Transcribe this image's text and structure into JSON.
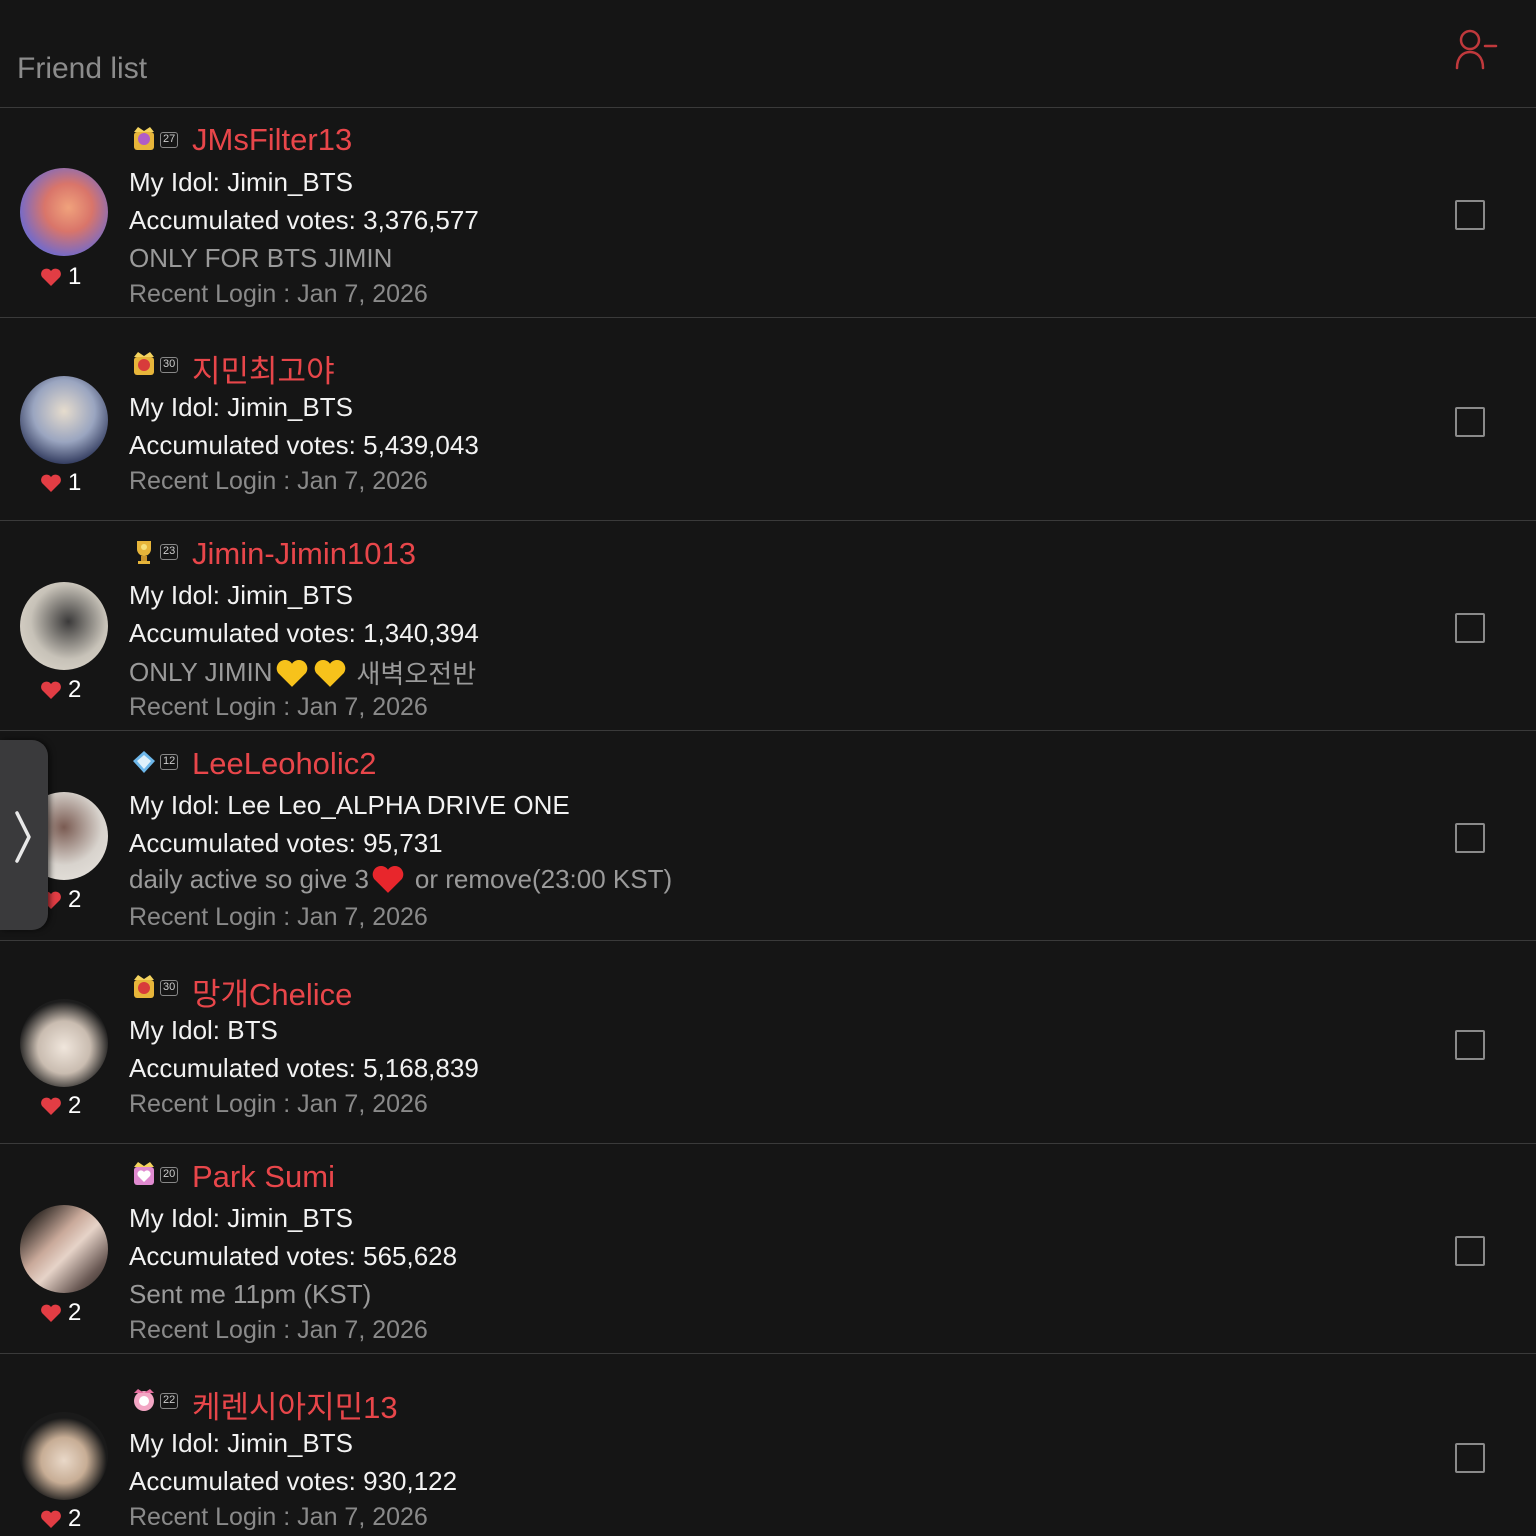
{
  "header": {
    "title": "Friend list",
    "remove_icon": "user-minus-icon"
  },
  "friends": [
    {
      "name": "JMsFilter13",
      "level": "27",
      "idol": "My Idol: Jimin_BTS",
      "votes": "Accumulated votes: 3,376,577",
      "message": "ONLY FOR BTS JIMIN",
      "login": "Recent Login : Jan 7, 2026",
      "hearts": "1"
    },
    {
      "name": "지민최고야",
      "level": "30",
      "idol": "My Idol: Jimin_BTS",
      "votes": "Accumulated votes: 5,439,043",
      "message": "",
      "login": "Recent Login : Jan 7, 2026",
      "hearts": "1"
    },
    {
      "name": "Jimin-Jimin1013",
      "level": "23",
      "idol": "My Idol: Jimin_BTS",
      "votes": "Accumulated votes: 1,340,394",
      "message_a": "ONLY JIMIN",
      "message_b": "새벽오전반",
      "login": "Recent Login : Jan 7, 2026",
      "hearts": "2"
    },
    {
      "name": "LeeLeoholic2",
      "level": "12",
      "idol": "My Idol: Lee Leo_ALPHA DRIVE ONE",
      "votes": "Accumulated votes: 95,731",
      "message_a": "daily active so give 3",
      "message_b": "or remove(23:00 KST)",
      "login": "Recent Login : Jan 7, 2026",
      "hearts": "2"
    },
    {
      "name": "망개Chelice",
      "level": "30",
      "idol": "My Idol: BTS",
      "votes": "Accumulated votes: 5,168,839",
      "message": "",
      "login": "Recent Login : Jan 7, 2026",
      "hearts": "2"
    },
    {
      "name": "Park Sumi",
      "level": "20",
      "idol": "My Idol: Jimin_BTS",
      "votes": "Accumulated votes: 565,628",
      "message": "Sent me 11pm (KST)",
      "login": "Recent Login : Jan 7, 2026",
      "hearts": "2"
    },
    {
      "name": "케렌시아지민13",
      "level": "22",
      "idol": "My Idol: Jimin_BTS",
      "votes": "Accumulated votes: 930,122",
      "message": "",
      "login": "Recent Login : Jan 7, 2026",
      "hearts": "2"
    }
  ],
  "colors": {
    "accent": "#e8464a",
    "background": "#151515",
    "divider": "#3a3a3a"
  }
}
